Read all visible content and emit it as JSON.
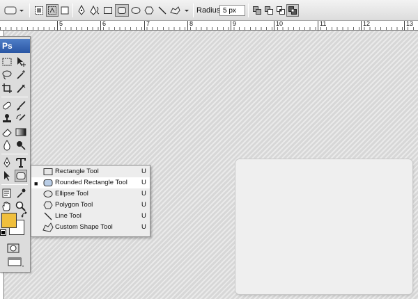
{
  "options_bar": {
    "radius_label": "Radius:",
    "radius_value": "5 px",
    "tool_preset_icon": "rounded-rectangle-preset-icon",
    "mode_icons": [
      "shape-layers-icon",
      "paths-icon",
      "fill-pixels-icon"
    ],
    "shape_icons": [
      "pen-icon",
      "freeform-pen-icon",
      "rectangle-icon",
      "rounded-rectangle-icon",
      "ellipse-icon",
      "polygon-icon",
      "line-icon",
      "custom-shape-icon"
    ],
    "combine_icons": [
      "add-to-shape-icon",
      "subtract-icon",
      "intersect-icon",
      "exclude-icon"
    ]
  },
  "ruler": {
    "ticks": [
      "5",
      "6",
      "7",
      "8",
      "9",
      "10",
      "11",
      "12",
      "13"
    ]
  },
  "toolbox": {
    "app_label": "Ps",
    "foreground_color": "#f0bf3c",
    "background_color": "#ffffff"
  },
  "flyout": {
    "items": [
      {
        "label": "Rectangle Tool",
        "shortcut": "U",
        "icon": "rectangle-tool-icon",
        "selected": false
      },
      {
        "label": "Rounded Rectangle Tool",
        "shortcut": "U",
        "icon": "rounded-rectangle-tool-icon",
        "selected": true
      },
      {
        "label": "Ellipse Tool",
        "shortcut": "U",
        "icon": "ellipse-tool-icon",
        "selected": false
      },
      {
        "label": "Polygon Tool",
        "shortcut": "U",
        "icon": "polygon-tool-icon",
        "selected": false
      },
      {
        "label": "Line Tool",
        "shortcut": "U",
        "icon": "line-tool-icon",
        "selected": false
      },
      {
        "label": "Custom Shape Tool",
        "shortcut": "U",
        "icon": "custom-shape-tool-icon",
        "selected": false
      }
    ]
  }
}
